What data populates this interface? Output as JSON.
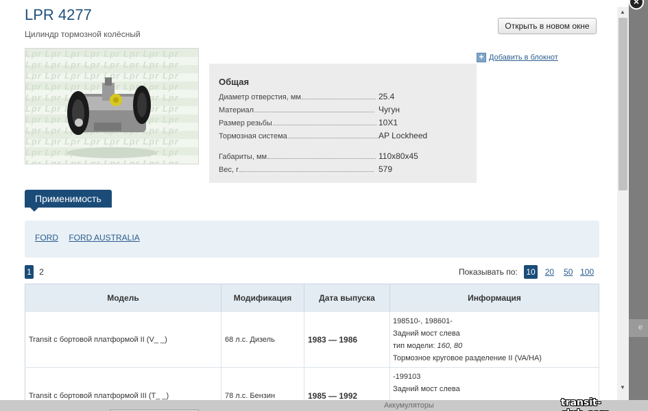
{
  "product": {
    "title": "LPR 4277",
    "subtitle": "Цилиндр тормозной колёсный",
    "open_new_window": "Открыть в новом окне",
    "add_to_notebook": "Добавить в блокнот",
    "watermark_text": "Lpr Lpr Lpr Lpr Lpr Lpr Lpr Lpr"
  },
  "specs": {
    "header": "Общая",
    "rows": [
      {
        "label": "Диаметр отверстия, мм",
        "value": "25.4"
      },
      {
        "label": "Материал",
        "value": "Чугун"
      },
      {
        "label": "Размер резьбы",
        "value": "10X1"
      },
      {
        "label": "Тормозная система",
        "value": "AP Lockheed"
      },
      {
        "label": "Габариты, мм",
        "value": "110x80x45"
      },
      {
        "label": "Вес, г",
        "value": "579"
      }
    ]
  },
  "applicability": {
    "tab_label": "Применимость",
    "makes": [
      "FORD",
      "FORD AUSTRALIA"
    ]
  },
  "pagination": {
    "pages": [
      "1",
      "2"
    ],
    "current": "1",
    "per_page_label": "Показывать по:",
    "per_page_options": [
      "10",
      "20",
      "50",
      "100"
    ],
    "per_page_current": "10"
  },
  "table": {
    "headers": [
      "Модель",
      "Модификация",
      "Дата выпуска",
      "Информация"
    ],
    "rows": [
      {
        "model": "Transit с бортовой платформой II (V_ _)",
        "modification": "68 л.с. Дизель",
        "date": "1983 — 1986",
        "info": [
          "198510-, 198601-",
          "Задний мост слева",
          "тип модели:",
          "160, 80",
          "Тормозное круговое разделение II (VA/HA)"
        ]
      },
      {
        "model": "Transit с бортовой платформой III (T_ _)",
        "modification": "78 л.с. Бензин",
        "date": "1985 — 1992",
        "info": [
          "-199103",
          "Задний мост слева"
        ]
      }
    ]
  },
  "background": {
    "link": "Аккумуляторы",
    "right_text": "е"
  },
  "site_watermark": "transit-club.com"
}
